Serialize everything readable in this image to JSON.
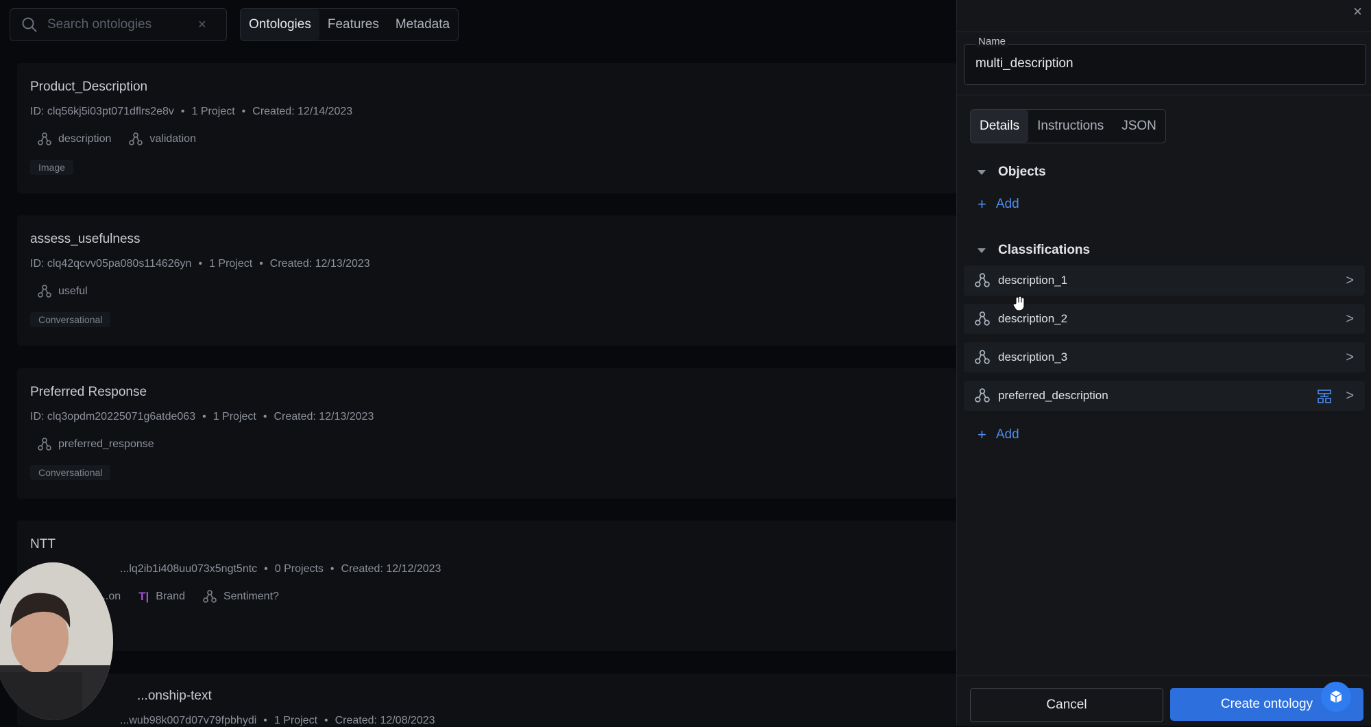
{
  "search": {
    "placeholder": "Search ontologies",
    "clear": "×"
  },
  "top_tabs": [
    {
      "label": "Ontologies"
    },
    {
      "label": "Features"
    },
    {
      "label": "Metadata"
    }
  ],
  "ontologies": [
    {
      "title": "Product_Description",
      "id": "ID: clq56kj5i03pt071dflrs2e8v",
      "projects": "1 Project",
      "created": "Created: 12/14/2023",
      "features": [
        {
          "name": "description"
        },
        {
          "name": "validation"
        }
      ],
      "type": "Image"
    },
    {
      "title": "assess_usefulness",
      "id": "ID: clq42qcvv05pa080s114626yn",
      "projects": "1 Project",
      "created": "Created: 12/13/2023",
      "features": [
        {
          "name": "useful"
        }
      ],
      "type": "Conversational"
    },
    {
      "title": "Preferred Response",
      "id": "ID: clq3opdm20225071g6atde063",
      "projects": "1 Project",
      "created": "Created: 12/13/2023",
      "features": [
        {
          "name": "preferred_response"
        }
      ],
      "type": "Conversational"
    },
    {
      "title": "NTT",
      "id": "...lq2ib1i408uu073x5ngt5ntc",
      "projects": "0 Projects",
      "created": "Created: 12/12/2023",
      "features": [
        {
          "name": "...on"
        },
        {
          "name": "Brand"
        },
        {
          "name": "Sentiment?"
        }
      ],
      "type": ""
    },
    {
      "title": "...onship-text",
      "id": "...wub98k007d07v79fpbhydi",
      "projects": "1 Project",
      "created": "Created: 12/08/2023",
      "features": [],
      "type": ""
    }
  ],
  "panel": {
    "close": "×",
    "name_label": "Name",
    "name_value": "multi_description",
    "tabs": [
      {
        "label": "Details"
      },
      {
        "label": "Instructions"
      },
      {
        "label": "JSON"
      }
    ],
    "objects_heading": "Objects",
    "add_label": "Add",
    "classifications_heading": "Classifications",
    "classifications": [
      {
        "label": "description_1"
      },
      {
        "label": "description_2"
      },
      {
        "label": "description_3"
      },
      {
        "label": "preferred_description"
      }
    ],
    "cancel_label": "Cancel",
    "create_label": "Create ontology"
  },
  "colors": {
    "accent": "#2d6fdd",
    "link": "#4d8df0",
    "text_type_icon": "#a04fd6"
  }
}
